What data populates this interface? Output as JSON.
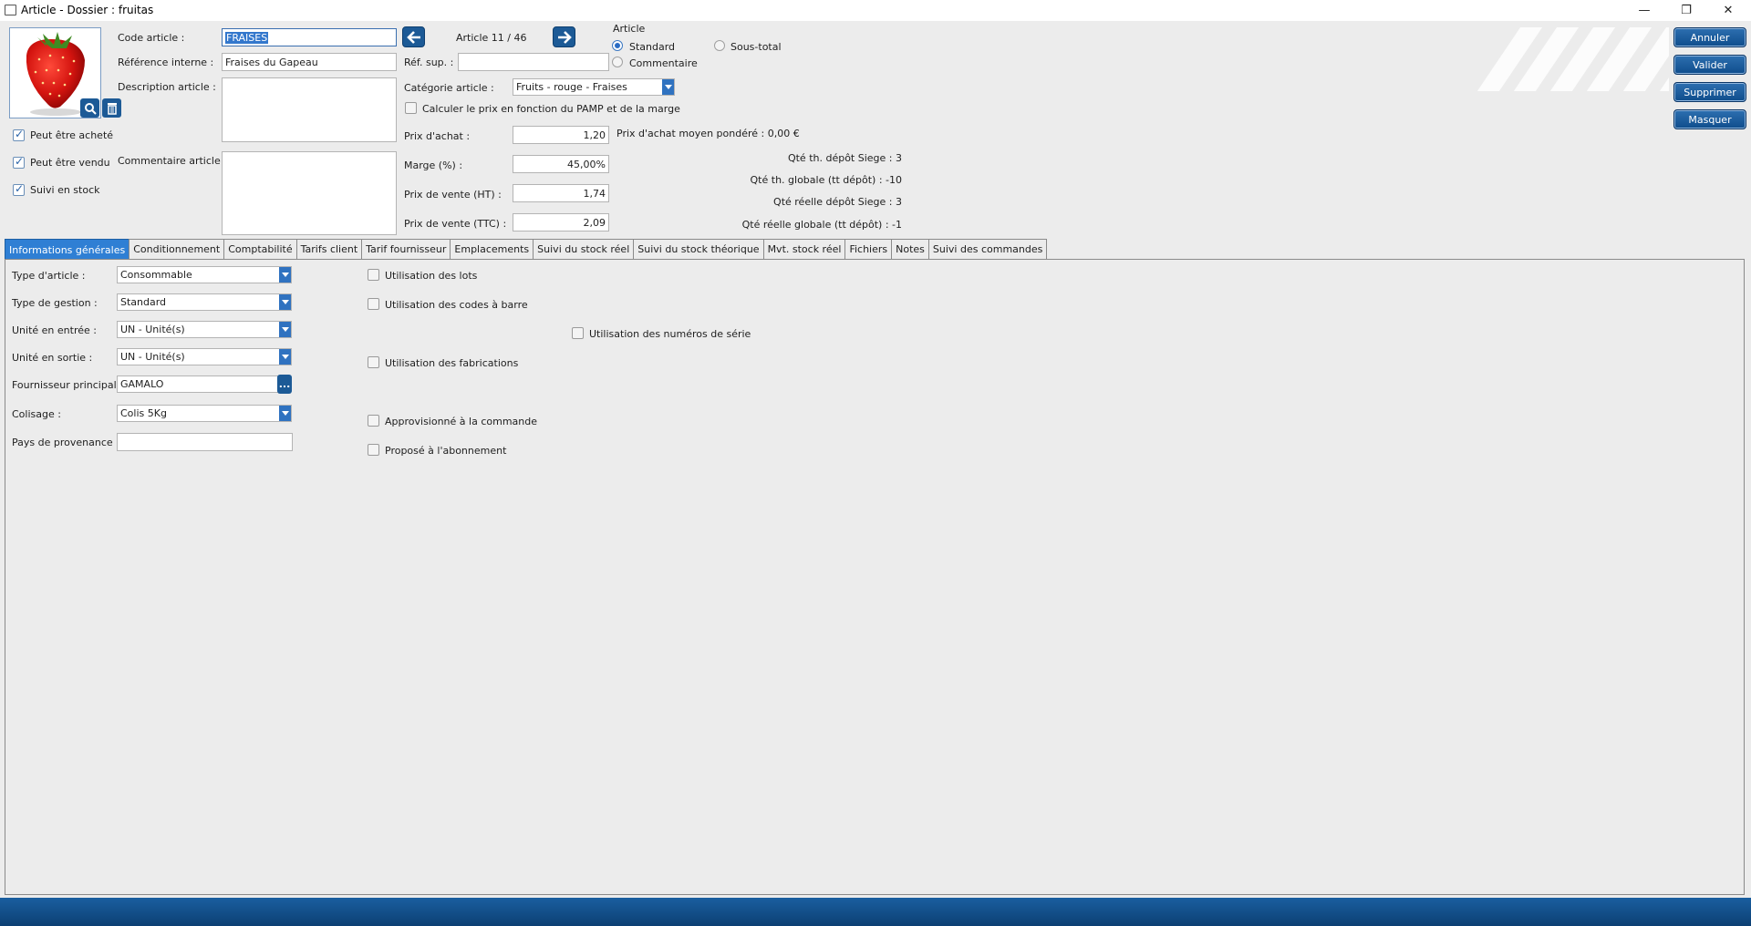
{
  "window": {
    "title": "Article - Dossier : fruitas",
    "minimize": "—",
    "restore": "❐",
    "close": "✕"
  },
  "header": {
    "code_label": "Code article :",
    "code_value": "FRAISES",
    "ref_interne_label": "Référence interne :",
    "ref_interne_value": "Fraises du Gapeau",
    "description_label": "Description article :",
    "commentaire_label": "Commentaire article :",
    "nav_counter": "Article 11 / 46",
    "ref_sup_label": "Réf. sup. :",
    "ref_sup_value": "",
    "article_group_label": "Article",
    "radio_standard": "Standard",
    "radio_sous_total": "Sous-total",
    "radio_commentaire": "Commentaire",
    "categorie_label": "Catégorie article :",
    "categorie_value": "Fruits - rouge - Fraises",
    "calc_prix_label": "Calculer le prix en fonction du PAMP et de la marge",
    "prix_achat_label": "Prix d'achat :",
    "prix_achat_value": "1,20",
    "pamp_text": "Prix d'achat moyen pondéré : 0,00 €",
    "marge_label": "Marge (%) :",
    "marge_value": "45,00%",
    "prix_ht_label": "Prix de vente (HT) :",
    "prix_ht_value": "1,74",
    "prix_ttc_label": "Prix de vente (TTC) :",
    "prix_ttc_value": "2,09",
    "qte_th_depot": "Qté th. dépôt Siege : 3",
    "qte_th_globale": "Qté th. globale (tt dépôt) : -10",
    "qte_reelle_depot": "Qté réelle dépôt Siege : 3",
    "qte_reelle_globale": "Qté réelle globale (tt dépôt) : -1",
    "peut_achete": "Peut être acheté",
    "peut_vendu": "Peut être vendu",
    "suivi_stock": "Suivi en stock"
  },
  "actions": {
    "annuler": "Annuler",
    "valider": "Valider",
    "supprimer": "Supprimer",
    "masquer": "Masquer"
  },
  "tabs": [
    {
      "label": "Informations générales"
    },
    {
      "label": "Conditionnement"
    },
    {
      "label": "Comptabilité"
    },
    {
      "label": "Tarifs client"
    },
    {
      "label": "Tarif fournisseur"
    },
    {
      "label": "Emplacements"
    },
    {
      "label": "Suivi du stock réel"
    },
    {
      "label": "Suivi du stock théorique"
    },
    {
      "label": "Mvt. stock réel"
    },
    {
      "label": "Fichiers"
    },
    {
      "label": "Notes"
    },
    {
      "label": "Suivi des commandes"
    }
  ],
  "general": {
    "type_article_label": "Type d'article :",
    "type_article_value": "Consommable",
    "type_gestion_label": "Type de gestion :",
    "type_gestion_value": "Standard",
    "unite_entree_label": "Unité en entrée :",
    "unite_entree_value": "UN - Unité(s)",
    "unite_sortie_label": "Unité en sortie :",
    "unite_sortie_value": "UN - Unité(s)",
    "fournisseur_label": "Fournisseur principal :",
    "fournisseur_value": "GAMALO",
    "fournisseur_btn": "...",
    "colisage_label": "Colisage :",
    "colisage_value": "Colis 5Kg",
    "pays_label": "Pays de provenance :",
    "pays_value": "",
    "util_lots": "Utilisation des lots",
    "util_codes_barre": "Utilisation des codes à barre",
    "util_num_serie": "Utilisation des numéros de série",
    "util_fabrications": "Utilisation des fabrications",
    "approvisionne": "Approvisionné à la commande",
    "propose_abonnement": "Proposé à l'abonnement"
  },
  "colors": {
    "accent": "#2f7fd4",
    "button": "#1c5a96",
    "statusbar": "#0c3f73"
  }
}
